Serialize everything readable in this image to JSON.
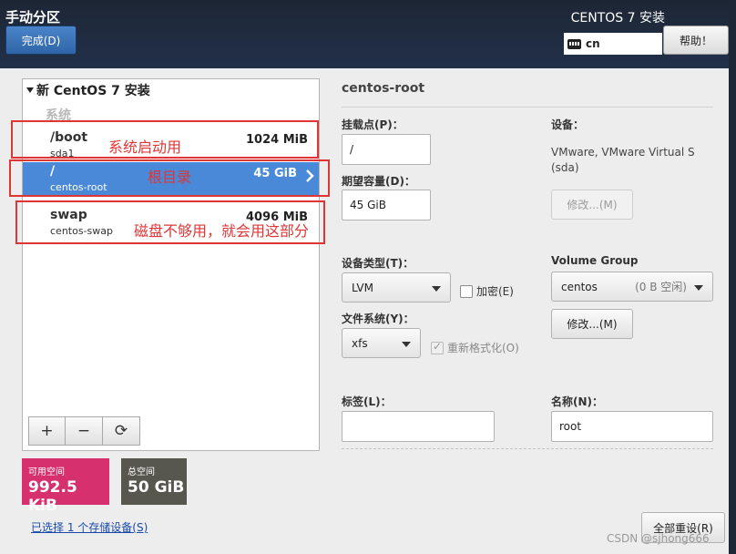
{
  "header": {
    "page_title": "手动分区",
    "done_label": "完成(D)",
    "product_title": "CENTOS 7 安装",
    "keyboard_layout": "cn",
    "help_label": "帮助！"
  },
  "tree": {
    "install_title": "新 CentOS 7 安装",
    "group_title": "系统",
    "partitions": [
      {
        "mount": "/boot",
        "device": "sda1",
        "size": "1024 MiB",
        "selected": false
      },
      {
        "mount": "/",
        "device": "centos-root",
        "size": "45 GiB",
        "selected": true
      },
      {
        "mount": "swap",
        "device": "centos-swap",
        "size": "4096 MiB",
        "selected": false
      }
    ],
    "toolbar": {
      "add": "+",
      "remove": "−",
      "refresh": "⟳"
    }
  },
  "annotations": {
    "boot": "系统启动用",
    "root": "根目录",
    "swap": "磁盘不够用，就会用这部分"
  },
  "space": {
    "available_label": "可用空间",
    "available_value": "992.5 KiB",
    "available_color": "#d6306e",
    "total_label": "总空间",
    "total_value": "50 GiB",
    "total_color": "#58574f",
    "storage_link": "已选择 1 个存储设备(S)"
  },
  "detail": {
    "title": "centos-root",
    "mount_label": "挂载点(P)：",
    "mount_value": "/",
    "capacity_label": "期望容量(D)：",
    "capacity_value": "45 GiB",
    "device_label": "设备：",
    "device_value": "VMware, VMware Virtual S (sda)",
    "modify_device_label": "修改...(M)",
    "device_type_label": "设备类型(T)：",
    "device_type_value": "LVM",
    "encrypt_label": "加密(E)",
    "volume_group_label": "Volume Group",
    "volume_group_value": "centos",
    "volume_group_free": "(0 B 空闲)",
    "modify_vg_label": "修改...(M)",
    "fs_label": "文件系统(Y)：",
    "fs_value": "xfs",
    "reformat_label": "重新格式化(O)",
    "tag_label": "标签(L)：",
    "tag_value": "",
    "name_label": "名称(N)：",
    "name_value": "root",
    "reset_all_label": "全部重设(R)"
  },
  "watermark": "CSDN @sjhong666"
}
